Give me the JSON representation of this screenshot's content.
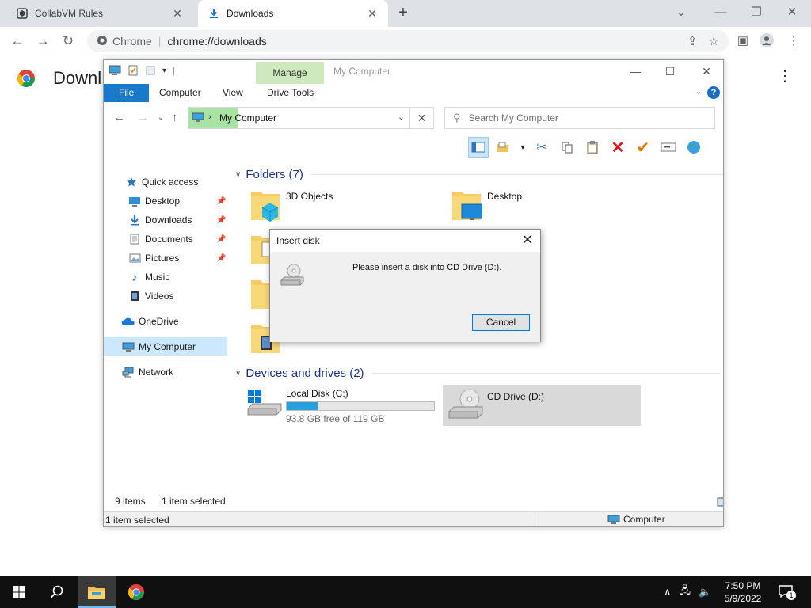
{
  "browser": {
    "tabs": [
      {
        "label": "CollabVM Rules",
        "icon": "collabvm-icon"
      },
      {
        "label": "Downloads",
        "icon": "download-icon"
      }
    ],
    "omnibox": {
      "site": "Chrome",
      "url": "chrome://downloads"
    },
    "page_title": "Downl"
  },
  "explorer": {
    "title": "My Computer",
    "ribbon": {
      "contextual_group": "Manage",
      "tabs": [
        "File",
        "Computer",
        "View",
        "Drive Tools"
      ]
    },
    "address": {
      "location": "My Computer"
    },
    "search": {
      "placeholder": "Search My Computer"
    },
    "nav": {
      "items": [
        {
          "label": "Quick access",
          "icon": "star-icon",
          "pinned": false
        },
        {
          "label": "Desktop",
          "icon": "desktop-icon",
          "pinned": true
        },
        {
          "label": "Downloads",
          "icon": "download-arrow-icon",
          "pinned": true
        },
        {
          "label": "Documents",
          "icon": "document-icon",
          "pinned": true
        },
        {
          "label": "Pictures",
          "icon": "pictures-icon",
          "pinned": true
        },
        {
          "label": "Music",
          "icon": "music-icon",
          "pinned": false
        },
        {
          "label": "Videos",
          "icon": "videos-icon",
          "pinned": false
        },
        {
          "label": "OneDrive",
          "icon": "cloud-icon",
          "pinned": false
        },
        {
          "label": "My Computer",
          "icon": "computer-icon",
          "pinned": false,
          "selected": true
        },
        {
          "label": "Network",
          "icon": "network-icon",
          "pinned": false
        }
      ]
    },
    "folders": {
      "header": "Folders (7)",
      "items": [
        {
          "label": "3D Objects"
        },
        {
          "label": "Desktop"
        }
      ]
    },
    "drives": {
      "header": "Devices and drives (2)",
      "items": [
        {
          "label": "Local Disk (C:)",
          "free": "93.8 GB free of 119 GB",
          "used_fraction": 0.21
        },
        {
          "label": "CD Drive (D:)",
          "selected": true
        }
      ]
    },
    "status": {
      "item_count": "9 items",
      "selection": "1 item selected",
      "bottom_left": "1 item selected",
      "bottom_right": "Computer"
    }
  },
  "dialog": {
    "title": "Insert disk",
    "message": "Please insert a disk into CD Drive (D:).",
    "cancel_label": "Cancel"
  },
  "taskbar": {
    "time": "7:50 PM",
    "date": "5/9/2022",
    "notification_count": "1"
  },
  "colors": {
    "accent": "#1979ca",
    "manage_tab": "#cfe9bf",
    "selection": "#cce8ff",
    "progress": "#26a0da"
  }
}
